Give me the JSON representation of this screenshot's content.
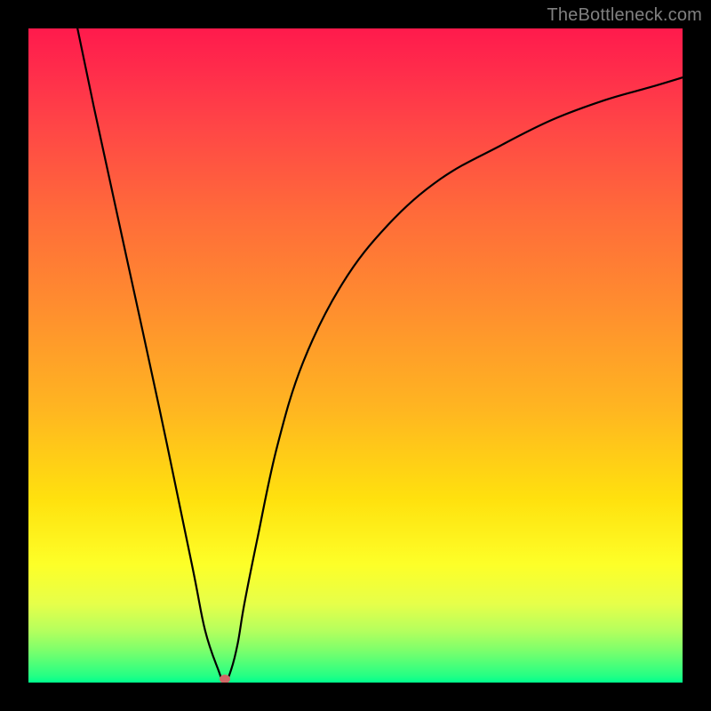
{
  "watermark": "TheBottleneck.com",
  "colors": {
    "border": "#000000",
    "curve": "#000000",
    "dip_dot": "#d16666",
    "watermark": "#808080",
    "gradient_stops": [
      "#ff1a4c",
      "#ff4646",
      "#ff8c2f",
      "#ffe10e",
      "#fdff28",
      "#24ff84",
      "#00ff8e"
    ]
  },
  "chart_data": {
    "type": "line",
    "title": "",
    "xlabel": "",
    "ylabel": "",
    "xlim": [
      0,
      100
    ],
    "ylim": [
      0,
      100
    ],
    "grid": false,
    "legend": false,
    "note": "No numeric axis ticks or labels are shown; x and values are expressed as 0–100 percentages of the plot area width/height, read from the image.",
    "series": [
      {
        "name": "curve",
        "x": [
          7.5,
          10,
          15,
          20,
          25,
          27,
          29,
          30,
          31,
          32,
          33,
          35,
          38,
          42,
          48,
          55,
          63,
          72,
          80,
          88,
          95,
          100
        ],
        "values": [
          100,
          88,
          65,
          42,
          18,
          8,
          2,
          0,
          2,
          6,
          12,
          22,
          36,
          49,
          61,
          70,
          77,
          82,
          86,
          89,
          91,
          92.5
        ]
      }
    ],
    "dip_marker": {
      "x": 30,
      "value": 0
    }
  }
}
